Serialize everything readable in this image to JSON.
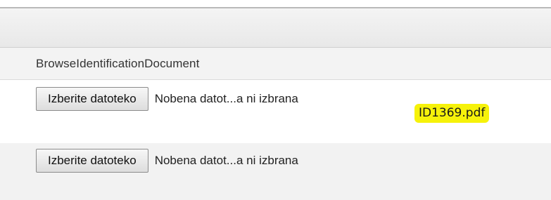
{
  "grid": {
    "column_header": "BrowseIdentificationDocument"
  },
  "rows": [
    {
      "button_label": "Izberite datoteko",
      "status_text": "Nobena datot...a ni izbrana",
      "annotation": "ID1369.pdf"
    },
    {
      "button_label": "Izberite datoteko",
      "status_text": "Nobena datot...a ni izbrana"
    }
  ],
  "colors": {
    "highlight": "#f6f20a",
    "alt_row_background": "#f2f2f2"
  }
}
